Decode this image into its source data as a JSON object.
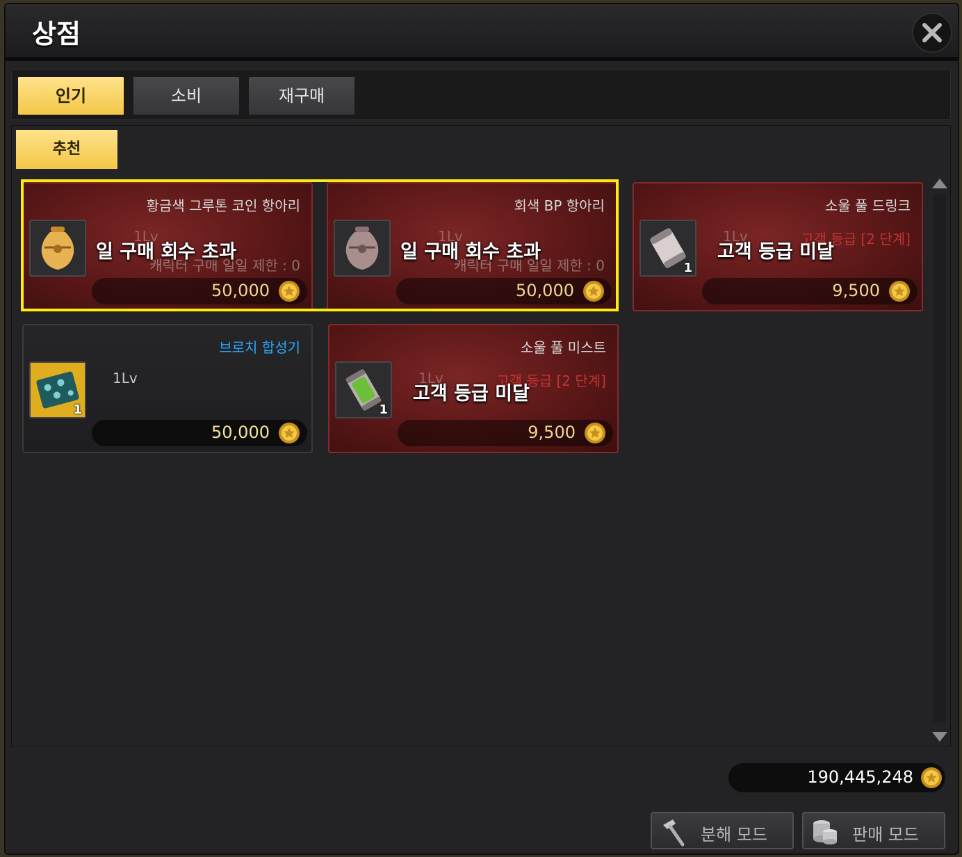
{
  "window": {
    "title": "상점"
  },
  "tabs": [
    {
      "label": "인기",
      "active": true
    },
    {
      "label": "소비",
      "active": false
    },
    {
      "label": "재구매",
      "active": false
    }
  ],
  "subtab": {
    "label": "추천"
  },
  "items": [
    {
      "name": "황금색 그루톤 코인 항아리",
      "icon": "golden-jar-icon",
      "level": "1Lv",
      "limit": "캐릭터 구매 일일 제한 : 0",
      "overlay": "일 구매 회수 초과",
      "price": "50,000",
      "quantity": ""
    },
    {
      "name": "회색 BP 항아리",
      "icon": "gray-jar-icon",
      "level": "1Lv",
      "limit": "캐릭터 구매 일일 제한 : 0",
      "overlay": "일 구매 회수 초과",
      "price": "50,000",
      "quantity": ""
    },
    {
      "name": "소울 풀 드링크",
      "icon": "soul-drink-icon",
      "level": "1Lv",
      "grade": "고객 등급 [2 단계]",
      "overlay": "고객 등급 미달",
      "price": "9,500",
      "quantity": "1"
    },
    {
      "name": "브로치 합성기",
      "icon": "brooch-combiner-icon",
      "level": "1Lv",
      "price": "50,000",
      "quantity": "1"
    },
    {
      "name": "소울 풀 미스트",
      "icon": "soul-mist-icon",
      "level": "1Lv",
      "grade": "고객 등급 [2 단계]",
      "overlay": "고객 등급 미달",
      "price": "9,500",
      "quantity": "1"
    }
  ],
  "footer": {
    "balance": "190,445,248",
    "disassemble_label": "분해 모드",
    "sell_label": "판매 모드"
  },
  "colors": {
    "accent": "#f3c748",
    "highlight": "#ffeb10",
    "card_red": "#5a1717"
  }
}
